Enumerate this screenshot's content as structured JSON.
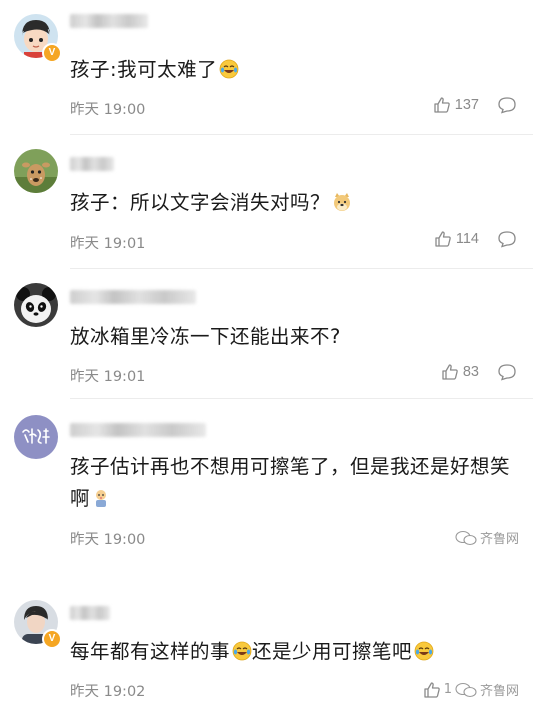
{
  "comments": [
    {
      "text": "孩子:我可太难了",
      "emoji": "laugh-cry",
      "time": "昨天 19:00",
      "likes": "137",
      "verified_badge": "V",
      "avatar": "cartoon-boy"
    },
    {
      "text": "孩子：所以文字会消失对吗？",
      "emoji": "doge",
      "time": "昨天 19:01",
      "likes": "114",
      "avatar": "deer"
    },
    {
      "text": "放冰箱里冷冻一下还能出来不?",
      "time": "昨天 19:01",
      "likes": "83",
      "avatar": "panda"
    },
    {
      "text": "孩子估计再也不想用可擦笔了，但是我还是好想笑啊",
      "emoji": "baby",
      "time": "昨天 19:00",
      "likes": "",
      "avatar": "calligraphy",
      "watermark": "齐鲁网"
    },
    {
      "text_part1": "每年都有这样的事",
      "text_part2": "还是少用可擦笔吧",
      "emoji": "laugh-cry",
      "time": "昨天 19:02",
      "likes": "1",
      "verified_badge": "V",
      "avatar": "portrait",
      "watermark": "齐鲁网"
    }
  ],
  "colors": {
    "text": "#1a1a1a",
    "meta": "#8a8a8a",
    "badge": "#f5a623",
    "divider": "#ececec"
  }
}
